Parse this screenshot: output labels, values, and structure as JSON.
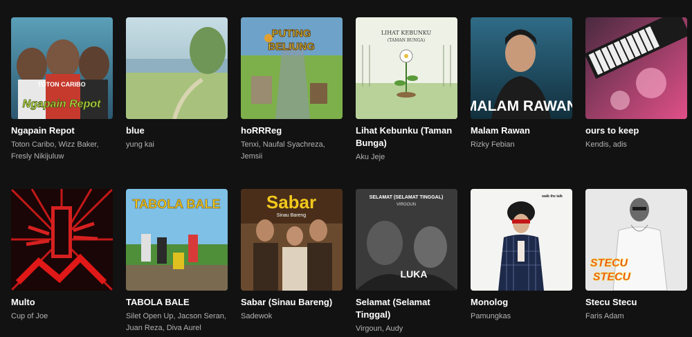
{
  "cards": [
    {
      "title": "Ngapain Repot",
      "artist": "Toton Caribo, Wizz Baker, Fresly Nikijuluw",
      "cover_text": "Ngapain Repot",
      "cover_top": "TOTON CARIBO"
    },
    {
      "title": "blue",
      "artist": "yung kai"
    },
    {
      "title": "hoRRReg",
      "artist": "Tenxi, Naufal Syachreza, Jemsii",
      "cover_text1": "PUTING",
      "cover_text2": "BELIUNG"
    },
    {
      "title": "Lihat Kebunku (Taman Bunga)",
      "artist": "Aku Jeje",
      "cover_text1": "LIHAT KEBUNKU",
      "cover_text2": "(TAMAN BUNGA)"
    },
    {
      "title": "Malam Rawan",
      "artist": "Rizky Febian",
      "cover_text": "MALAM RAWAN"
    },
    {
      "title": "ours to keep",
      "artist": "Kendis, adis"
    },
    {
      "title": "Multo",
      "artist": "Cup of Joe"
    },
    {
      "title": "TABOLA BALE",
      "artist": "Silet Open Up, Jacson Seran, Juan Reza, Diva Aurel",
      "cover_text": "TABOLA BALE"
    },
    {
      "title": "Sabar (Sinau Bareng)",
      "artist": "Sadewok",
      "cover_text": "Sabar",
      "cover_sub": "Sinau Bareng"
    },
    {
      "title": "Selamat (Selamat Tinggal)",
      "artist": "Virgoun, Audy",
      "cover_text": "SELAMAT (SELAMAT TINGGAL)",
      "cover_sub": "VIRGOUN",
      "cover_text3": "LUKA"
    },
    {
      "title": "Monolog",
      "artist": "Pamungkas",
      "cover_text": "walk the talk"
    },
    {
      "title": "Stecu Stecu",
      "artist": "Faris Adam",
      "cover_text1": "STECU",
      "cover_text2": "STECU"
    }
  ],
  "colors": {
    "background": "#121212",
    "title": "#ffffff",
    "subtitle": "#b3b3b3"
  }
}
